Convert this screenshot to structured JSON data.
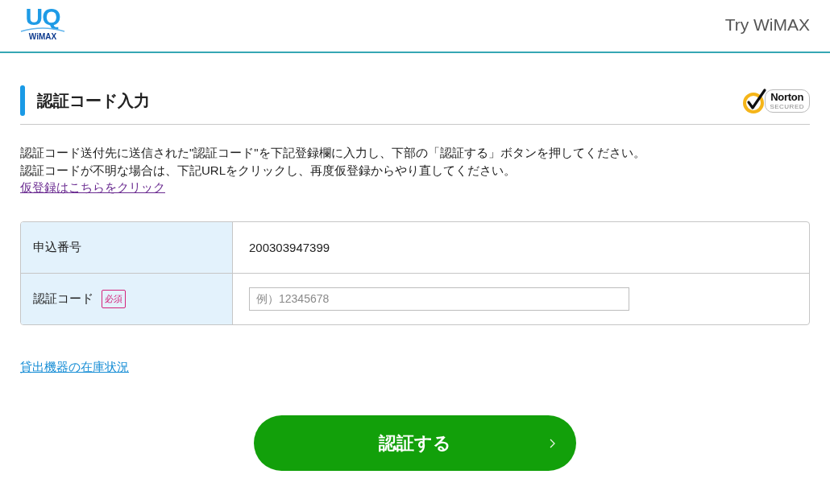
{
  "header": {
    "logo": {
      "mark": "UQ",
      "wordmark": "WiMAX"
    },
    "site_title": "Try WiMAX"
  },
  "section": {
    "title": "認証コード入力",
    "seal": {
      "name": "Norton",
      "caption": "SECURED"
    }
  },
  "instructions": [
    "認証コード送付先に送信された\"認証コード\"を下記登録欄に入力し、下部の「認証する」ボタンを押してください。",
    "認証コードが不明な場合は、下記URLをクリックし、再度仮登録からやり直してください。"
  ],
  "retry_link": "仮登録はこちらをクリック",
  "form": {
    "rows": [
      {
        "kind": "text",
        "label": "申込番号",
        "value": "200303947399"
      },
      {
        "kind": "input",
        "label": "認証コード",
        "tag": "必須",
        "placeholder": "例）12345678"
      }
    ]
  },
  "stock_link": "貸出機器の在庫状況",
  "submit": {
    "label": "認証する"
  }
}
